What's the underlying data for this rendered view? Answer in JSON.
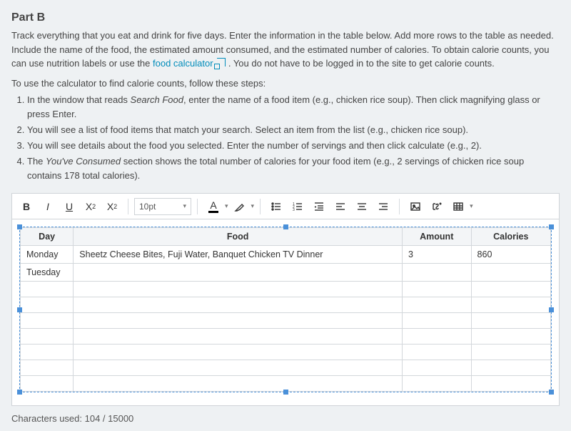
{
  "title": "Part B",
  "instructions_html_parts": {
    "p1a": "Track everything that you eat and drink for five days. Enter the information in the table below. Add more rows to the table as needed. Include the name of the food, the estimated amount consumed, and the estimated number of calories. To obtain calorie counts, you can use nutrition labels or use the ",
    "link_text": "food calculator",
    "p1b": " . You do not have to be logged in to the site to get calorie counts."
  },
  "steps_lead": "To use the calculator to find calorie counts, follow these steps:",
  "steps": [
    {
      "pre": "In the window that reads ",
      "em": "Search Food",
      "post": ", enter the name of a food item (e.g., chicken rice soup). Then click magnifying glass or press Enter."
    },
    {
      "pre": "",
      "em": "",
      "post": "You will see a list of food items that match your search. Select an item from the list (e.g., chicken rice soup)."
    },
    {
      "pre": "",
      "em": "",
      "post": "You will see details about the food you selected. Enter the number of servings and then click calculate (e.g., 2)."
    },
    {
      "pre": "The ",
      "em": "You've Consumed",
      "post": " section shows the total number of calories for your food item (e.g., 2 servings of chicken rice soup contains 178 total calories)."
    }
  ],
  "toolbar": {
    "font_size": "10pt"
  },
  "table": {
    "headers": [
      "Day",
      "Food",
      "Amount",
      "Calories"
    ],
    "rows": [
      {
        "day": "Monday",
        "food": "Sheetz Cheese Bites, Fuji Water, Banquet Chicken TV Dinner",
        "amount": "3",
        "calories": "860"
      },
      {
        "day": "Tuesday",
        "food": "",
        "amount": "",
        "calories": ""
      },
      {
        "day": "",
        "food": "",
        "amount": "",
        "calories": ""
      },
      {
        "day": "",
        "food": "",
        "amount": "",
        "calories": ""
      },
      {
        "day": "",
        "food": "",
        "amount": "",
        "calories": ""
      },
      {
        "day": "",
        "food": "",
        "amount": "",
        "calories": ""
      },
      {
        "day": "",
        "food": "",
        "amount": "",
        "calories": ""
      },
      {
        "day": "",
        "food": "",
        "amount": "",
        "calories": ""
      },
      {
        "day": "",
        "food": "",
        "amount": "",
        "calories": ""
      }
    ]
  },
  "char_count": {
    "label": "Characters used: ",
    "value": "104 / 15000"
  }
}
